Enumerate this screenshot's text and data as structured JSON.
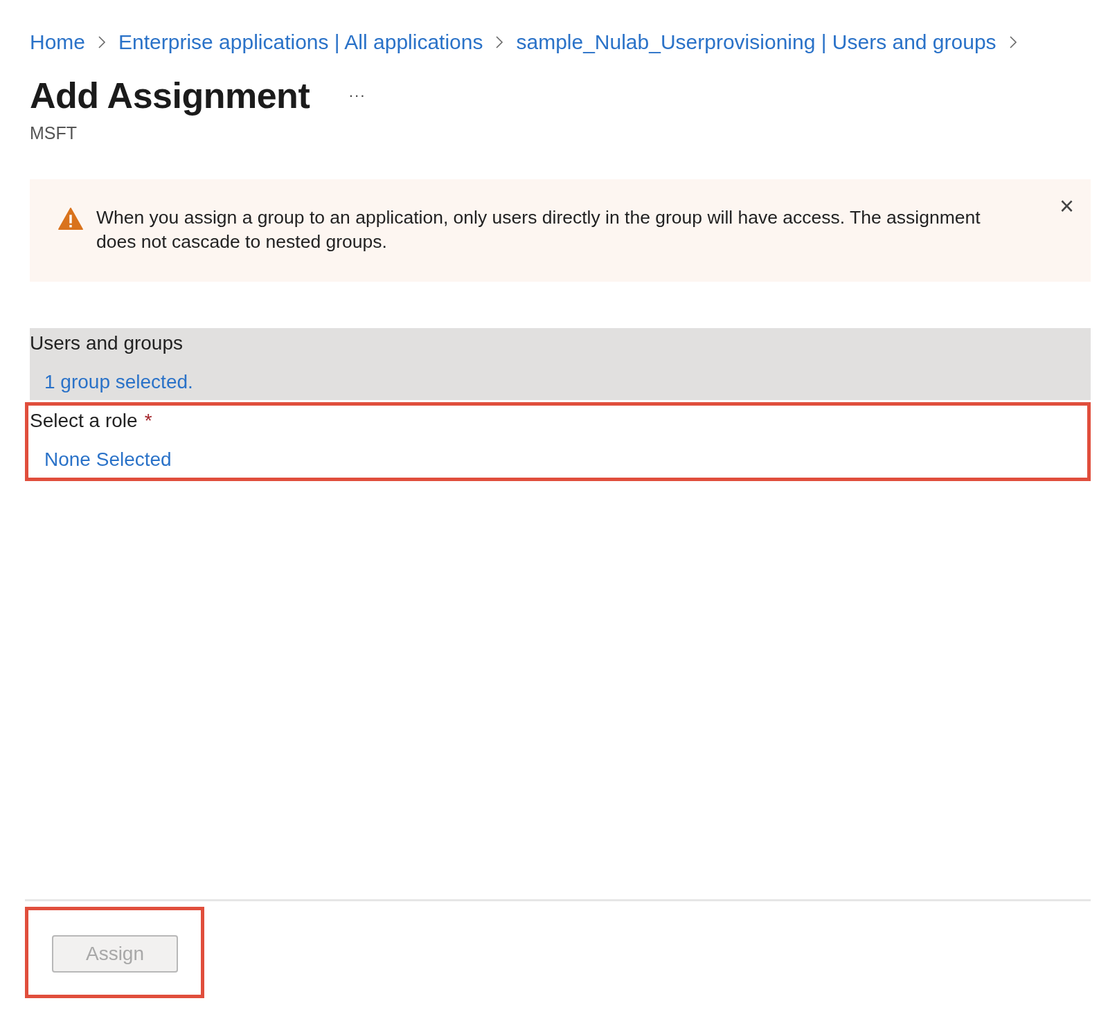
{
  "breadcrumb": [
    {
      "label": "Home"
    },
    {
      "label": "Enterprise applications | All applications"
    },
    {
      "label": "sample_Nulab_Userprovisioning | Users and groups"
    }
  ],
  "title": "Add Assignment",
  "more_button": "···",
  "subtitle": "MSFT",
  "warning": {
    "text": "When you assign a group to an application, only users directly in the group will have access. The assignment does not cascade to nested groups.",
    "close": "×"
  },
  "sections": [
    {
      "label": "Users and groups",
      "value": "1 group selected.",
      "shaded": true,
      "highlighted": false
    },
    {
      "label": "Select a role",
      "required_mark": "*",
      "value": "None Selected",
      "shaded": false,
      "highlighted": true
    }
  ],
  "footer": {
    "button": {
      "label": "Assign",
      "disabled": true,
      "highlighted": true
    }
  }
}
